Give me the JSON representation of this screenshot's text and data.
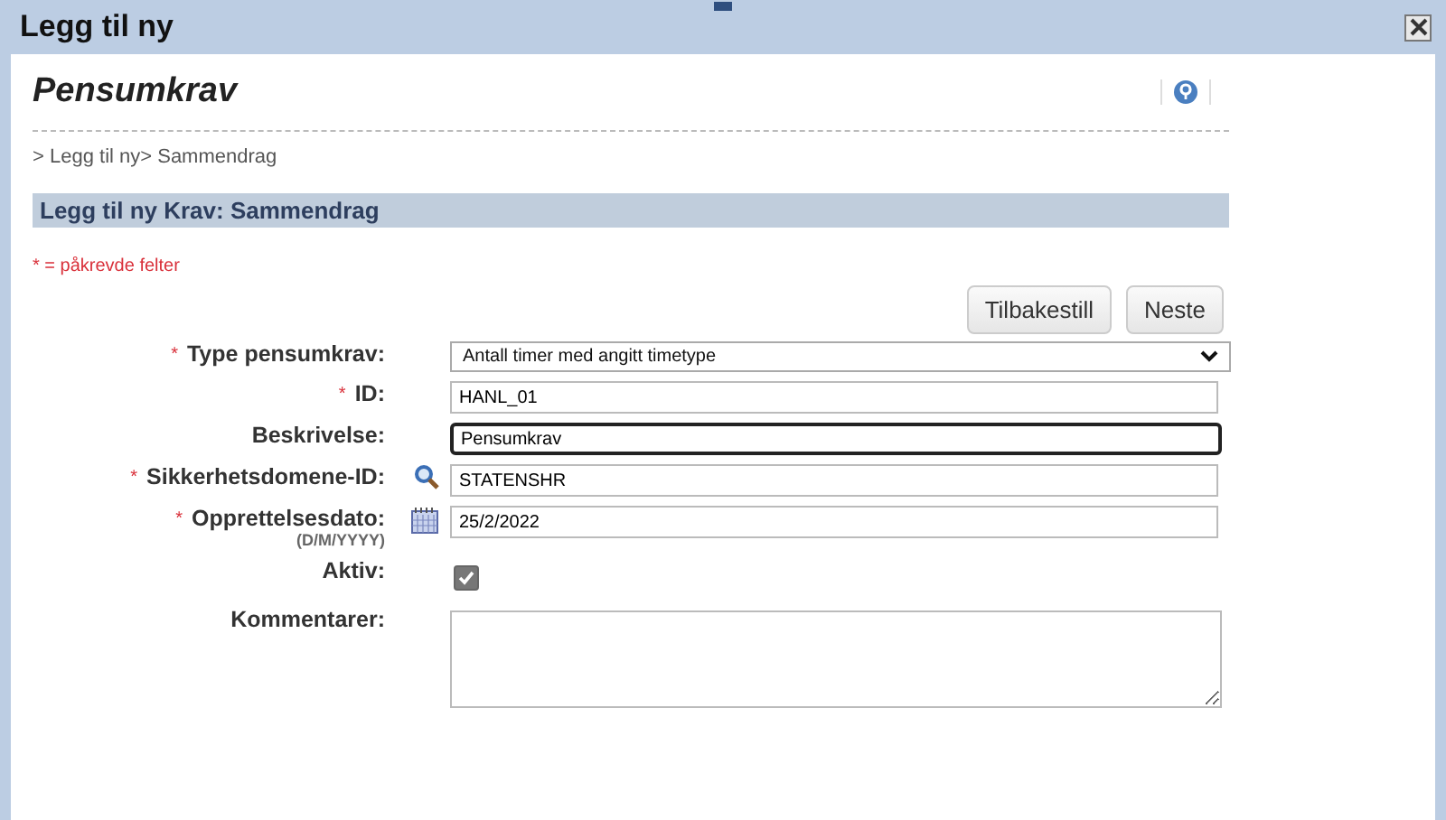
{
  "window": {
    "title": "Legg til ny"
  },
  "page": {
    "title": "Pensumkrav",
    "breadcrumb": "> Legg til ny> Sammendrag",
    "section_title": "Legg til ny Krav: Sammendrag",
    "required_note": "* = påkrevde felter"
  },
  "buttons": [
    "Tilbakestill",
    "Neste"
  ],
  "fields": [
    {
      "kind": "select",
      "label": "Type pensumkrav:",
      "mark": "*",
      "value": "Antall timer med angitt timetype"
    },
    {
      "kind": "text",
      "label": "ID:",
      "mark": "*",
      "value": "HANL_01",
      "focused": false
    },
    {
      "kind": "text",
      "label": "Beskrivelse:",
      "value": "Pensumkrav",
      "focused": true
    },
    {
      "kind": "search",
      "label": "Sikkerhetsdomene-ID:",
      "mark": "*",
      "value": "STATENSHR",
      "focused": false
    },
    {
      "kind": "date",
      "label": "Opprettelsesdato:",
      "mark": "*",
      "hint": "(D/M/YYYY)",
      "value": "25/2/2022",
      "focused": false
    },
    {
      "kind": "checkbox",
      "label": "Aktiv:",
      "checked": true
    },
    {
      "kind": "textarea",
      "label": "Kommentarer:"
    }
  ]
}
